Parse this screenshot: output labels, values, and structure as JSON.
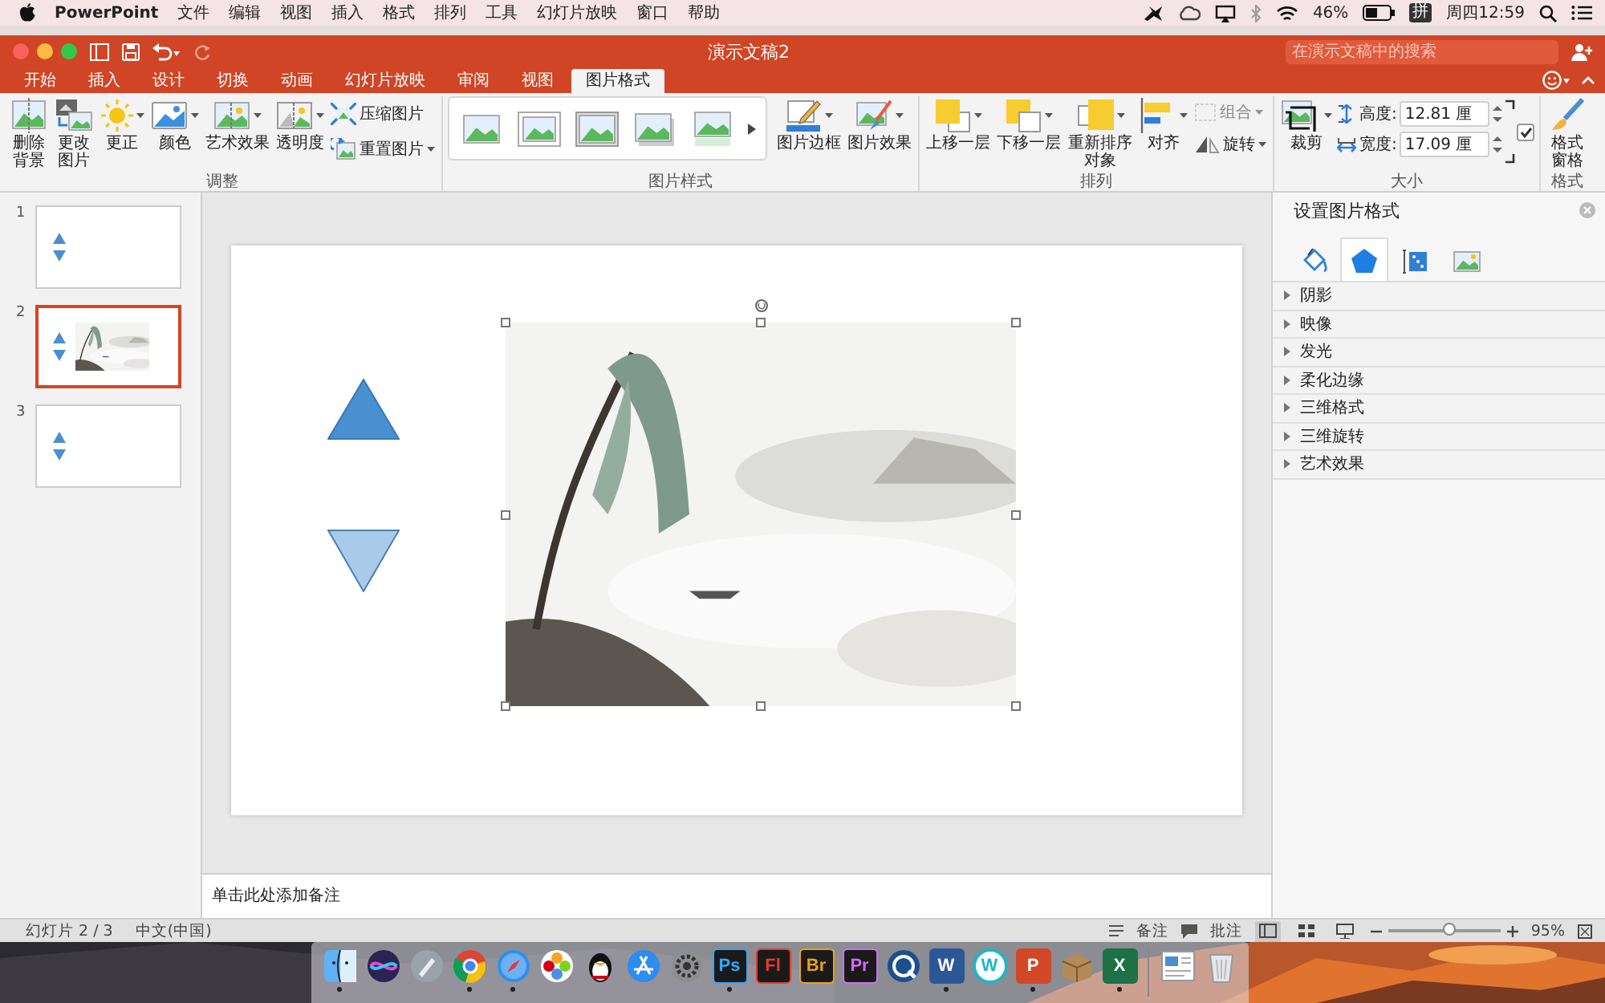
{
  "menubar": {
    "app": "PowerPoint",
    "menus": [
      "文件",
      "编辑",
      "视图",
      "插入",
      "格式",
      "排列",
      "工具",
      "幻灯片放映",
      "窗口",
      "帮助"
    ],
    "battery": "46%",
    "input_method": "拼",
    "clock": "周四12:59"
  },
  "window": {
    "title": "演示文稿2",
    "search": {
      "placeholder": "在演示文稿中的搜索"
    }
  },
  "tabs": [
    {
      "label": "开始",
      "selected": false
    },
    {
      "label": "插入",
      "selected": false
    },
    {
      "label": "设计",
      "selected": false
    },
    {
      "label": "切换",
      "selected": false
    },
    {
      "label": "动画",
      "selected": false
    },
    {
      "label": "幻灯片放映",
      "selected": false
    },
    {
      "label": "审阅",
      "selected": false
    },
    {
      "label": "视图",
      "selected": false
    },
    {
      "label": "图片格式",
      "selected": true
    }
  ],
  "ribbon": {
    "groups": [
      {
        "label": "调整",
        "buttons": [
          {
            "label": "删除背景",
            "kind": "narrow",
            "dropdown": false,
            "disabled": false
          },
          {
            "label": "更改图片",
            "kind": "narrow",
            "dropdown": false,
            "disabled": false
          },
          {
            "label": "更正",
            "kind": "large",
            "dropdown": true,
            "disabled": false
          },
          {
            "label": "颜色",
            "kind": "large",
            "dropdown": true,
            "disabled": false
          },
          {
            "label": "艺术效果",
            "kind": "large",
            "dropdown": true,
            "disabled": false
          },
          {
            "label": "透明度",
            "kind": "large",
            "dropdown": true,
            "disabled": false
          },
          {
            "label": "压缩图片",
            "kind": "small",
            "dropdown": false,
            "disabled": false
          },
          {
            "label": "重置图片",
            "kind": "small",
            "dropdown": true,
            "disabled": false
          }
        ]
      },
      {
        "label": "图片样式",
        "gallery": [
          {
            "kind": "plain"
          },
          {
            "kind": "frame"
          },
          {
            "kind": "thick-frame"
          },
          {
            "kind": "shadow"
          },
          {
            "kind": "reflection"
          }
        ],
        "buttons": [
          {
            "label": "图片边框",
            "kind": "large",
            "dropdown": true,
            "disabled": false
          },
          {
            "label": "图片效果",
            "kind": "large",
            "dropdown": true,
            "disabled": false
          }
        ]
      },
      {
        "label": "排列",
        "buttons": [
          {
            "label": "上移一层",
            "kind": "large",
            "dropdown": true,
            "disabled": false
          },
          {
            "label": "下移一层",
            "kind": "large",
            "dropdown": true,
            "disabled": false
          },
          {
            "label": "重新排序对象",
            "kind": "large",
            "dropdown": true,
            "disabled": false
          },
          {
            "label": "对齐",
            "kind": "large",
            "dropdown": true,
            "disabled": false
          },
          {
            "label": "组合",
            "kind": "small",
            "dropdown": true,
            "disabled": true
          },
          {
            "label": "旋转",
            "kind": "small",
            "dropdown": true,
            "disabled": false
          }
        ]
      },
      {
        "label": "大小",
        "buttons": [
          {
            "label": "裁剪",
            "kind": "large",
            "dropdown": true,
            "disabled": false
          }
        ],
        "size_fields": [
          {
            "label": "高度:",
            "value": "12.81 厘"
          },
          {
            "label": "宽度:",
            "value": "17.09 厘"
          }
        ],
        "lock_aspect": {
          "checked": true
        }
      },
      {
        "label": "格式",
        "buttons": [
          {
            "label": "格式窗格",
            "kind": "narrow",
            "dropdown": false,
            "disabled": false
          }
        ]
      }
    ]
  },
  "slides": [
    {
      "number": "1",
      "selected": false,
      "picture": false
    },
    {
      "number": "2",
      "selected": true,
      "picture": true
    },
    {
      "number": "3",
      "selected": false,
      "picture": false
    }
  ],
  "slide": {
    "shapes": [
      {
        "kind": "triangle-up"
      },
      {
        "kind": "triangle-down"
      },
      {
        "kind": "picture",
        "selected": true
      }
    ]
  },
  "notes": {
    "text": "单击此处添加备注"
  },
  "format_pane": {
    "title": "设置图片格式",
    "tabs": [
      {
        "selected": false
      },
      {
        "selected": true
      },
      {
        "selected": false
      },
      {
        "selected": false
      }
    ],
    "sections": [
      {
        "label": "阴影",
        "expanded": false
      },
      {
        "label": "映像",
        "expanded": false
      },
      {
        "label": "发光",
        "expanded": false
      },
      {
        "label": "柔化边缘",
        "expanded": false
      },
      {
        "label": "三维格式",
        "expanded": false
      },
      {
        "label": "三维旋转",
        "expanded": false
      },
      {
        "label": "艺术效果",
        "expanded": false
      }
    ]
  },
  "status": {
    "slide_count": "幻灯片 2 / 3",
    "language": "中文(中国)",
    "notes": "备注",
    "comments": "批注",
    "views": [
      {
        "selected": true
      },
      {
        "selected": false
      },
      {
        "selected": false
      }
    ],
    "zoom": {
      "level": 0.55,
      "reading": "95%"
    }
  },
  "dock": [
    {
      "kind": "finder",
      "running": true
    },
    {
      "kind": "siri",
      "running": false
    },
    {
      "kind": "launchpad",
      "running": false
    },
    {
      "kind": "chrome",
      "running": true
    },
    {
      "kind": "safari",
      "running": true
    },
    {
      "kind": "photos",
      "running": false
    },
    {
      "kind": "penguin",
      "running": false
    },
    {
      "kind": "appstore",
      "running": false
    },
    {
      "kind": "settings",
      "running": false
    },
    {
      "kind": "tile",
      "label": "Ps",
      "color": "#31a8ff",
      "running": true
    },
    {
      "kind": "tile",
      "label": "Fl",
      "color": "#e23b2e",
      "running": false
    },
    {
      "kind": "tile",
      "label": "Br",
      "color": "#e8a317",
      "running": false
    },
    {
      "kind": "tile",
      "label": "Pr",
      "color": "#d36bf7",
      "running": false
    },
    {
      "kind": "quicktime",
      "running": false
    },
    {
      "kind": "office",
      "label": "W",
      "color": "#2b5797",
      "running": true
    },
    {
      "kind": "circle",
      "label": "W",
      "color": "#1fb5c9",
      "running": false
    },
    {
      "kind": "office",
      "label": "P",
      "color": "#d24726",
      "running": true
    },
    {
      "kind": "archive",
      "running": false
    },
    {
      "kind": "office",
      "label": "X",
      "color": "#1e7145",
      "running": true
    },
    {
      "kind": "separator"
    },
    {
      "kind": "document",
      "running": false
    },
    {
      "kind": "trash",
      "running": false
    }
  ]
}
